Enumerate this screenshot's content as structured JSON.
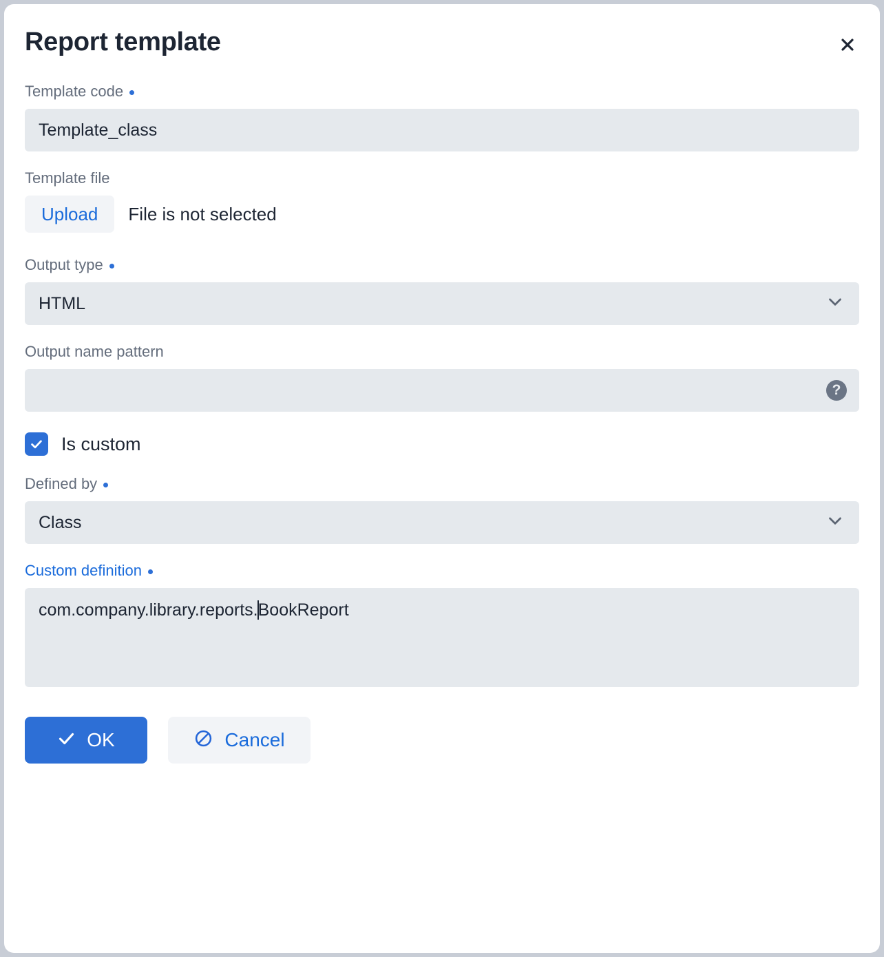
{
  "dialog": {
    "title": "Report template",
    "close_icon": "close-icon"
  },
  "fields": {
    "template_code": {
      "label": "Template code",
      "required": true,
      "value": "Template_class"
    },
    "template_file": {
      "label": "Template file",
      "required": false,
      "upload_label": "Upload",
      "status": "File is not selected"
    },
    "output_type": {
      "label": "Output type",
      "required": true,
      "value": "HTML",
      "chevron_icon": "chevron-down-icon"
    },
    "output_name_pattern": {
      "label": "Output name pattern",
      "required": false,
      "value": "",
      "placeholder": "",
      "help_icon": "help-circle-icon",
      "help_glyph": "?"
    },
    "is_custom": {
      "label": "Is custom",
      "checked": true
    },
    "defined_by": {
      "label": "Defined by",
      "required": true,
      "value": "Class",
      "chevron_icon": "chevron-down-icon"
    },
    "custom_definition": {
      "label": "Custom definition",
      "required": true,
      "focused": true,
      "value_before_caret": "com.company.library.reports.",
      "value_after_caret": "BookReport",
      "value": "com.company.library.reports.BookReport"
    }
  },
  "footer": {
    "ok_label": "OK",
    "ok_icon": "check-icon",
    "cancel_label": "Cancel",
    "cancel_icon": "ban-icon"
  },
  "colors": {
    "accent": "#2d6fd6",
    "link": "#1a6bdb",
    "input_bg": "#e5e9ed",
    "label": "#646d7c",
    "text": "#1d2533",
    "button_light_bg": "#f2f4f7"
  }
}
